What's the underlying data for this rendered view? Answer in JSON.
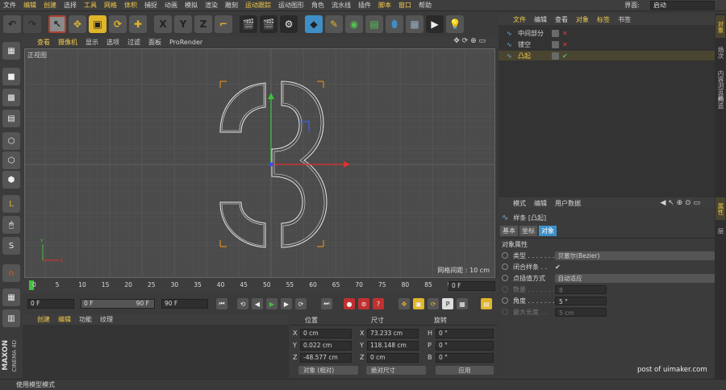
{
  "menubar": {
    "items": [
      "文件",
      "编辑",
      "创建",
      "选择",
      "工具",
      "网格",
      "体积",
      "捕捉",
      "动画",
      "模拟",
      "渲染",
      "雕刻",
      "运动跟踪",
      "运动图形",
      "角色",
      "流水线",
      "插件",
      "脚本",
      "窗口",
      "帮助"
    ],
    "layout_label": "界面:",
    "layout_value": "启动"
  },
  "toolbar": {
    "icons": [
      "undo-icon",
      "redo-icon",
      "live-select-icon",
      "move-icon",
      "scale-icon",
      "rotate-icon",
      "recent-tool-icon",
      "lock-x-icon",
      "lock-y-icon",
      "lock-z-icon",
      "coord-system-icon",
      "render-view-icon",
      "render-picture-icon",
      "render-settings-icon",
      "cube-icon",
      "pen-icon",
      "nurbs-icon",
      "array-icon",
      "deformer-icon",
      "floor-icon",
      "camera-icon",
      "light-icon"
    ],
    "x_label": "X",
    "y_label": "Y",
    "z_label": "Z"
  },
  "viewport": {
    "menu": [
      "查看",
      "摄像机",
      "显示",
      "选项",
      "过滤",
      "面板",
      "ProRender"
    ],
    "title": "正视图",
    "grid_info": "网格间距 : 10 cm"
  },
  "timeline": {
    "ticks": [
      "0",
      "5",
      "10",
      "15",
      "20",
      "25",
      "30",
      "35",
      "40",
      "45",
      "50",
      "55",
      "60",
      "65",
      "70",
      "75",
      "80",
      "85",
      "90"
    ],
    "current_frame": "0 F"
  },
  "controls": {
    "start": "0 F",
    "range_start": "0 F",
    "range_end": "90 F",
    "end": "90 F"
  },
  "material": {
    "menu": [
      "创建",
      "编辑",
      "功能",
      "纹理"
    ]
  },
  "coords": {
    "headers": [
      "位置",
      "尺寸",
      "旋转"
    ],
    "rows": [
      {
        "axis": "X",
        "pos": "0 cm",
        "size_axis": "X",
        "size": "73.233 cm",
        "rot_axis": "H",
        "rot": "0 °"
      },
      {
        "axis": "Y",
        "pos": "0.022 cm",
        "size_axis": "Y",
        "size": "118.148 cm",
        "rot_axis": "P",
        "rot": "0 °"
      },
      {
        "axis": "Z",
        "pos": "-48.577 cm",
        "size_axis": "Z",
        "size": "0 cm",
        "rot_axis": "B",
        "rot": "0 °"
      }
    ],
    "mode": "对象 (相对)",
    "size_mode": "绝对尺寸",
    "apply": "应用"
  },
  "objects": {
    "menu": [
      "文件",
      "编辑",
      "查看",
      "对象",
      "标签",
      "书签"
    ],
    "items": [
      {
        "name": "中间部分",
        "state": "x"
      },
      {
        "name": "镂空",
        "state": "x"
      },
      {
        "name": "凸起",
        "state": "check"
      }
    ]
  },
  "side_tabs": [
    "对象",
    "场次",
    "内容浏览器",
    "构造",
    "属性",
    "层"
  ],
  "attributes": {
    "menu": [
      "模式",
      "编辑",
      "用户数据"
    ],
    "object_title": "样条 [凸起]",
    "tabs": [
      "基本",
      "坐标",
      "对象"
    ],
    "section": "对象属性",
    "rows": [
      {
        "label": "类型 . . . . . . .",
        "value": "贝塞尔(Bezier)"
      },
      {
        "label": "闭合样条 . .",
        "value": "✔"
      },
      {
        "label": "点插值方式",
        "value": "自动适应"
      },
      {
        "label": "数量 . . . . . . .",
        "value": "8"
      },
      {
        "label": "角度 . . . . . . .",
        "value": "5 °"
      },
      {
        "label": "最大长度 . .",
        "value": "5 cm"
      }
    ]
  },
  "status": "使用模型模式",
  "watermark": "post of uimaker.com",
  "logo": {
    "line1": "MAXON",
    "line2": "CINEMA 4D"
  }
}
